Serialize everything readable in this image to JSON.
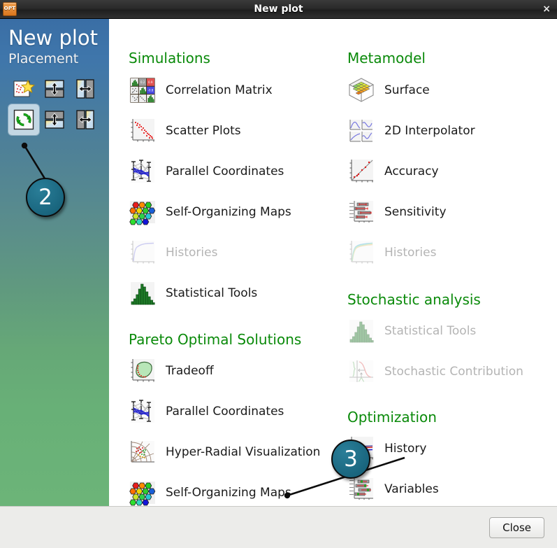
{
  "window": {
    "title": "New plot",
    "app_icon": "opt-app-icon",
    "app_icon_text": "OPT",
    "close_icon": "close-icon",
    "close_glyph": "×"
  },
  "sidebar": {
    "title": "New plot",
    "subtitle": "Placement",
    "placement_buttons": [
      {
        "name": "placement-new-window",
        "icon": "new-plot-star-icon",
        "selected": false
      },
      {
        "name": "placement-split-horizontal-top",
        "icon": "split-top-icon",
        "selected": false
      },
      {
        "name": "placement-split-vertical-left",
        "icon": "split-left-icon",
        "selected": false
      },
      {
        "name": "placement-replace",
        "icon": "replace-refresh-icon",
        "selected": true
      },
      {
        "name": "placement-split-horizontal-bottom",
        "icon": "split-bottom-icon",
        "selected": false
      },
      {
        "name": "placement-split-vertical-right",
        "icon": "split-right-icon",
        "selected": false
      }
    ]
  },
  "callouts": [
    {
      "label": "2",
      "target": "placement-replace"
    },
    {
      "label": "3",
      "target": "optimization-history"
    }
  ],
  "sections": {
    "simulations": {
      "heading": "Simulations",
      "items": [
        {
          "label": "Correlation Matrix",
          "icon": "correlation-matrix-icon",
          "disabled": false
        },
        {
          "label": "Scatter Plots",
          "icon": "scatter-plot-icon",
          "disabled": false
        },
        {
          "label": "Parallel Coordinates",
          "icon": "parallel-coordinates-icon",
          "disabled": false
        },
        {
          "label": "Self-Organizing Maps",
          "icon": "self-organizing-maps-icon",
          "disabled": false
        },
        {
          "label": "Histories",
          "icon": "histories-icon",
          "disabled": true
        },
        {
          "label": "Statistical Tools",
          "icon": "statistical-tools-icon",
          "disabled": false
        }
      ]
    },
    "pareto": {
      "heading": "Pareto Optimal Solutions",
      "items": [
        {
          "label": "Tradeoff",
          "icon": "tradeoff-icon",
          "disabled": false
        },
        {
          "label": "Parallel Coordinates",
          "icon": "parallel-coordinates-icon",
          "disabled": false
        },
        {
          "label": "Hyper-Radial Visualization",
          "icon": "hyper-radial-icon",
          "disabled": false
        },
        {
          "label": "Self-Organizing Maps",
          "icon": "self-organizing-maps-icon",
          "disabled": false
        }
      ]
    },
    "metamodel": {
      "heading": "Metamodel",
      "items": [
        {
          "label": "Surface",
          "icon": "surface-3d-icon",
          "disabled": false
        },
        {
          "label": "2D Interpolator",
          "icon": "interpolator-2d-icon",
          "disabled": false
        },
        {
          "label": "Accuracy",
          "icon": "accuracy-icon",
          "disabled": false
        },
        {
          "label": "Sensitivity",
          "icon": "sensitivity-icon",
          "disabled": false
        },
        {
          "label": "Histories",
          "icon": "histories-multi-icon",
          "disabled": true
        }
      ]
    },
    "stochastic": {
      "heading": "Stochastic analysis",
      "items": [
        {
          "label": "Statistical Tools",
          "icon": "statistical-tools-icon",
          "disabled": true
        },
        {
          "label": "Stochastic Contribution",
          "icon": "stochastic-contribution-icon",
          "disabled": true
        }
      ]
    },
    "optimization": {
      "heading": "Optimization",
      "items": [
        {
          "label": "History",
          "icon": "optimization-history-icon",
          "disabled": false
        },
        {
          "label": "Variables",
          "icon": "optimization-variables-icon",
          "disabled": false
        }
      ]
    }
  },
  "footer": {
    "close_label": "Close"
  },
  "colors": {
    "heading_green": "#0a8a0a",
    "sidebar_top": "#3a6ea5",
    "sidebar_bottom": "#6cb478",
    "callout_fill": "#1d6b84",
    "disabled_text": "#b4b4b4",
    "titlebar": "#2a2a2a"
  }
}
